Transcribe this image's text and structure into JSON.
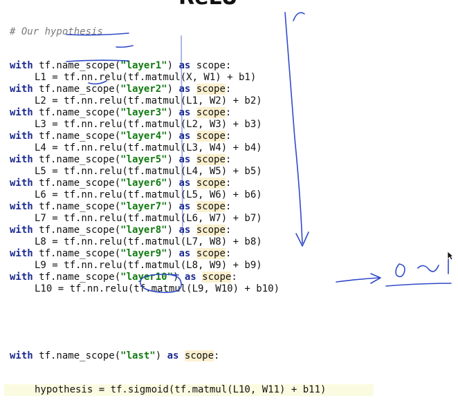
{
  "slide": {
    "title_fragment": "ReLU"
  },
  "code": {
    "comment": "# Our hypothesis",
    "kw_with": "with",
    "kw_as": "as",
    "kw_scope": "scope",
    "call_name_scope": " tf.name_scope(",
    "call_close": ") ",
    "colon": ":",
    "layers": [
      {
        "scope": "\"layer1\"",
        "stmt": "L1 = tf.nn.relu(tf.matmul(X, W1) + b1)"
      },
      {
        "scope": "\"layer2\"",
        "stmt": "L2 = tf.nn.relu(tf.matmul(L1, W2) + b2)"
      },
      {
        "scope": "\"layer3\"",
        "stmt": "L3 = tf.nn.relu(tf.matmul(L2, W3) + b3)"
      },
      {
        "scope": "\"layer4\"",
        "stmt": "L4 = tf.nn.relu(tf.matmul(L3, W4) + b4)"
      },
      {
        "scope": "\"layer5\"",
        "stmt": "L5 = tf.nn.relu(tf.matmul(L4, W5) + b5)"
      },
      {
        "scope": "\"layer6\"",
        "stmt": "L6 = tf.nn.relu(tf.matmul(L5, W6) + b6)"
      },
      {
        "scope": "\"layer7\"",
        "stmt": "L7 = tf.nn.relu(tf.matmul(L6, W7) + b7)"
      },
      {
        "scope": "\"layer8\"",
        "stmt": "L8 = tf.nn.relu(tf.matmul(L7, W8) + b8)"
      },
      {
        "scope": "\"layer9\"",
        "stmt": "L9 = tf.nn.relu(tf.matmul(L8, W9) + b9)"
      },
      {
        "scope": "\"layer10\"",
        "stmt": "L10 = tf.nn.relu(tf.matmul(L9, W10) + b10)"
      }
    ],
    "last": {
      "scope": "\"last\"",
      "stmt": "hypothesis = tf.sigmoid(tf.matmul(L10, W11) + b11)"
    }
  },
  "annotations": {
    "handwritten": "0 ~ 1",
    "ink_color": "#2f49c9"
  },
  "colors": {
    "keyword": "#1b2a8f",
    "string": "#127a12",
    "comment": "#7a7a7a",
    "highlight": "#fbf0cf"
  }
}
